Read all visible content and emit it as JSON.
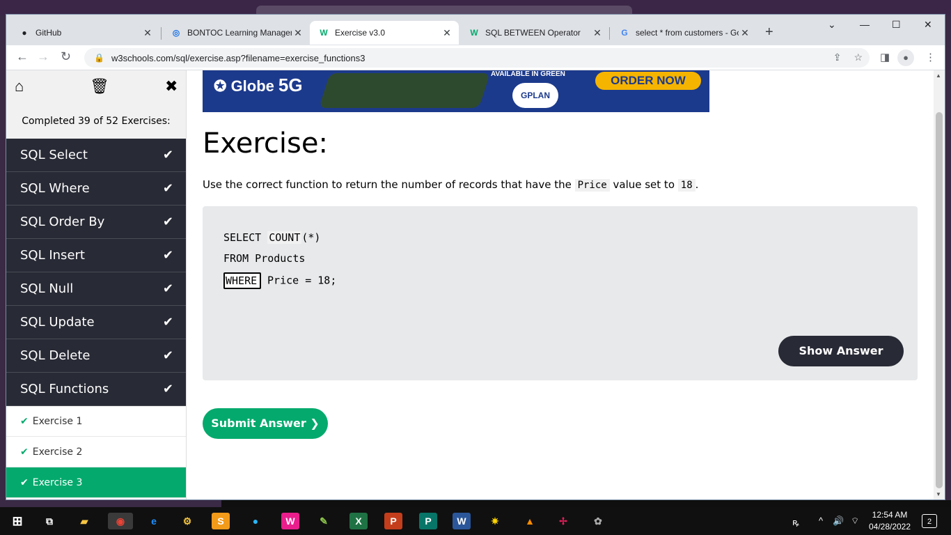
{
  "browser": {
    "tabs": [
      {
        "title": "GitHub",
        "favicon": "github-icon"
      },
      {
        "title": "BONTOC Learning Managem",
        "favicon": "lms-icon"
      },
      {
        "title": "Exercise v3.0",
        "favicon": "w3schools-icon",
        "active": true
      },
      {
        "title": "SQL BETWEEN Operator",
        "favicon": "w3schools-icon"
      },
      {
        "title": "select * from customers - Go",
        "favicon": "google-icon"
      }
    ],
    "url": "w3schools.com/sql/exercise.asp?filename=exercise_functions3"
  },
  "sidebar": {
    "progress_text": "Completed 39 of 52 Exercises:",
    "lessons": [
      {
        "label": "SQL Select",
        "done": true
      },
      {
        "label": "SQL Where",
        "done": true
      },
      {
        "label": "SQL Order By",
        "done": true
      },
      {
        "label": "SQL Insert",
        "done": true
      },
      {
        "label": "SQL Null",
        "done": true
      },
      {
        "label": "SQL Update",
        "done": true
      },
      {
        "label": "SQL Delete",
        "done": true
      },
      {
        "label": "SQL Functions",
        "done": true
      }
    ],
    "exercises": [
      {
        "label": "Exercise 1",
        "done": true
      },
      {
        "label": "Exercise 2",
        "done": true
      },
      {
        "label": "Exercise 3",
        "done": true,
        "current": true
      }
    ]
  },
  "ad": {
    "brand": "Globe",
    "brand_5g": "5G",
    "available": "AVAILABLE IN GREEN",
    "gplan": "GPLAN",
    "order": "ORDER NOW"
  },
  "main": {
    "title": "Exercise:",
    "instruction_before": "Use the correct function to return the number of records that have the ",
    "instruction_code1": "Price",
    "instruction_middle": " value set to ",
    "instruction_code2": "18",
    "instruction_after": ".",
    "code": {
      "line1_prefix": "SELECT ",
      "line1_filled": "COUNT",
      "line1_suffix": "(*)",
      "line2": "FROM Products",
      "line3_input_value": "WHERE",
      "line3_suffix": " Price = 18;"
    },
    "show_answer": "Show Answer",
    "submit": "Submit Answer ❯"
  },
  "taskbar": {
    "time": "12:54 AM",
    "date": "04/28/2022",
    "notifications": "2"
  },
  "colors": {
    "w3_green": "#04aa6d",
    "w3_dark": "#282a35",
    "code_bg": "#e7e9eb"
  }
}
